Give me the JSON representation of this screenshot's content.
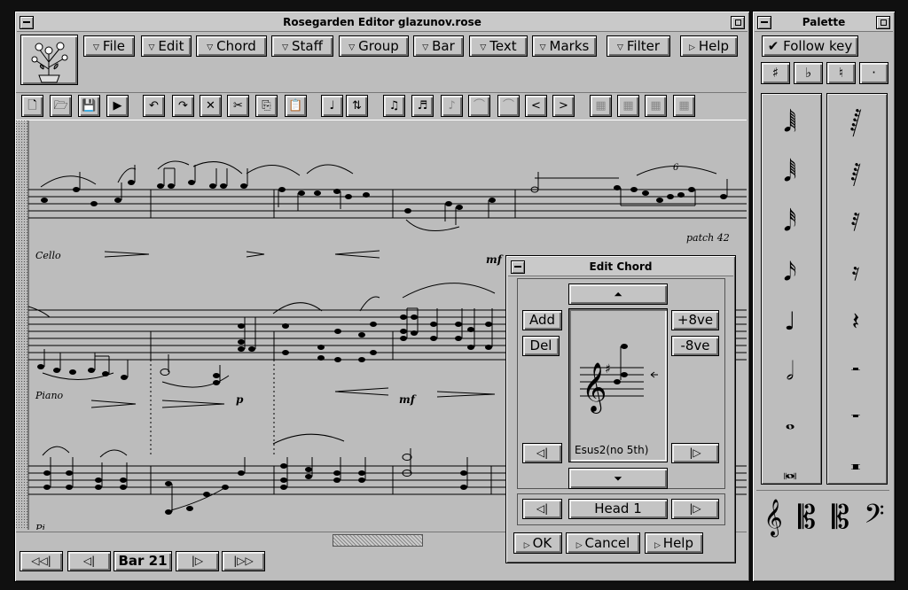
{
  "editor": {
    "title": "Rosegarden Editor  glazunov.rose",
    "menus": [
      "File",
      "Edit",
      "Chord",
      "Staff",
      "Group",
      "Bar",
      "Text",
      "Marks",
      "Filter"
    ],
    "help_label": "Help",
    "toolbar_icons": [
      "new-icon",
      "open-icon",
      "save-icon",
      "play-icon",
      "undo-icon",
      "redo-icon",
      "delete-icon",
      "cut-icon",
      "copy-icon",
      "paste-icon",
      "note-icon",
      "flip-stem-icon",
      "beam-icon",
      "beam2-icon",
      "beam3-icon",
      "tie-icon",
      "tie2-icon",
      "crescendo-icon",
      "decrescendo-icon",
      "grid-icon",
      "grid2-icon",
      "grid3-icon",
      "grid4-icon"
    ],
    "labels": {
      "cello": "Cello",
      "piano": "Piano",
      "patch": "patch 42",
      "mf_top": "mf",
      "mf_mid": "mf",
      "p": "p",
      "triplet": "6",
      "bottom_partial": "Pi"
    },
    "nav": {
      "bar_label": "Bar 21"
    }
  },
  "chord": {
    "title": "Edit Chord",
    "add": "Add",
    "del": "Del",
    "up8": "+8ve",
    "down8": "-8ve",
    "name": "Esus2(no 5th)",
    "head": "Head 1",
    "ok": "OK",
    "cancel": "Cancel",
    "help": "Help"
  },
  "palette": {
    "title": "Palette",
    "follow_key": "Follow key",
    "accidentals": [
      "♯",
      "♭",
      "♮",
      "·"
    ],
    "notes": [
      "128th-note",
      "64th-note",
      "32nd-note",
      "16th-note",
      "quarter-note",
      "half-note",
      "whole-note",
      "breve"
    ],
    "rests": [
      "128th-rest",
      "64th-rest",
      "32nd-rest",
      "16th-rest",
      "quarter-rest",
      "half-rest",
      "whole-rest",
      "breve-rest"
    ],
    "clefs": [
      "treble-clef",
      "alto-clef",
      "tenor-clef",
      "bass-clef"
    ]
  }
}
